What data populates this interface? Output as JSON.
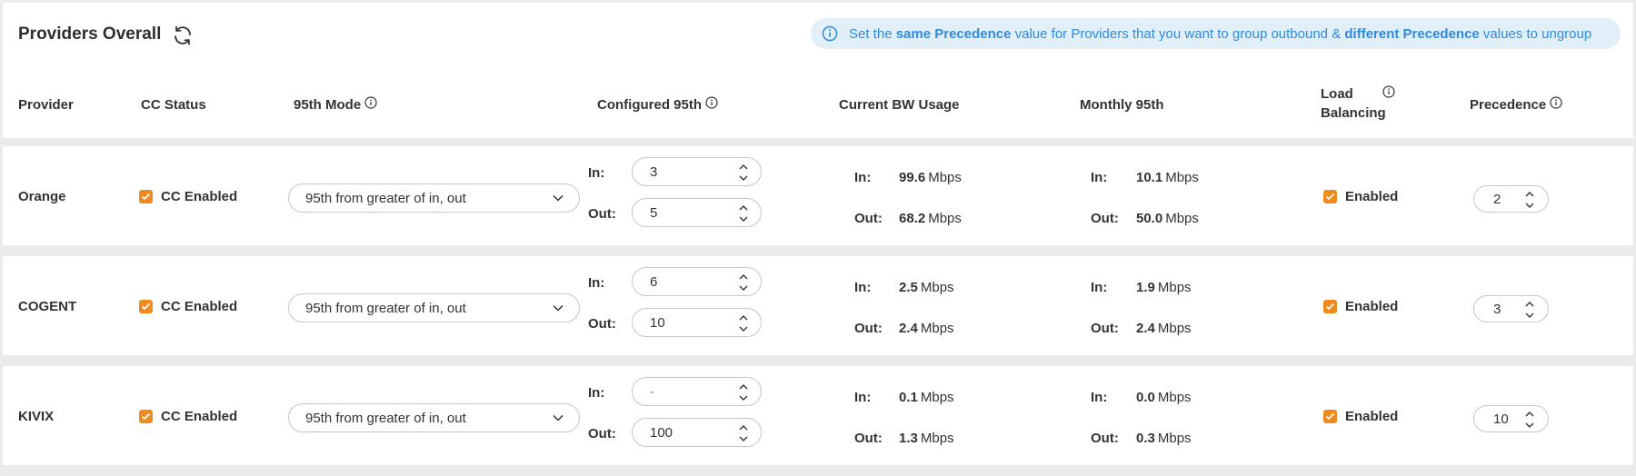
{
  "header": {
    "title": "Providers Overall",
    "info": {
      "t1": "Set the ",
      "b1": "same Precedence",
      "t2": " value for Providers that you want to group outbound & ",
      "b2": "different Precedence",
      "t3": " values to ungroup"
    },
    "columns": {
      "provider": "Provider",
      "cc_status": "CC Status",
      "mode": "95th Mode",
      "configured": "Configured 95th",
      "current_bw": "Current BW Usage",
      "monthly": "Monthly 95th",
      "load_balancing_1": "Load",
      "load_balancing_2": "Balancing",
      "precedence": "Precedence"
    }
  },
  "labels": {
    "in": "In:",
    "out": "Out:",
    "unit": "Mbps"
  },
  "accent_color": "#ef8a1e",
  "info_color": "#2f8ae2",
  "rows": [
    {
      "provider": "Orange",
      "cc_status": "CC Enabled",
      "mode": "95th from greater of in, out",
      "cfg_in": "3",
      "cfg_out": "5",
      "bw_in": "99.6",
      "bw_out": "68.2",
      "m_in": "10.1",
      "m_out": "50.0",
      "lb": "Enabled",
      "precedence": "2"
    },
    {
      "provider": "COGENT",
      "cc_status": "CC Enabled",
      "mode": "95th from greater of in, out",
      "cfg_in": "6",
      "cfg_out": "10",
      "bw_in": "2.5",
      "bw_out": "2.4",
      "m_in": "1.9",
      "m_out": "2.4",
      "lb": "Enabled",
      "precedence": "3"
    },
    {
      "provider": "KIVIX",
      "cc_status": "CC Enabled",
      "mode": "95th from greater of in, out",
      "cfg_in": "-",
      "cfg_out": "100",
      "bw_in": "0.1",
      "bw_out": "1.3",
      "m_in": "0.0",
      "m_out": "0.3",
      "lb": "Enabled",
      "precedence": "10"
    }
  ]
}
